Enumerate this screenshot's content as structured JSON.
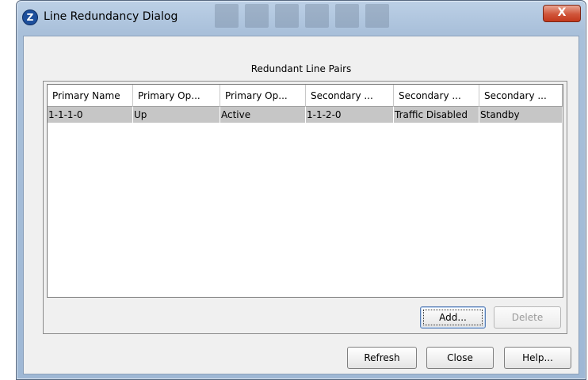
{
  "window": {
    "title": "Line Redundancy Dialog",
    "app_icon_glyph": "Z",
    "close_glyph": "X"
  },
  "group": {
    "title": "Redundant Line Pairs"
  },
  "table": {
    "columns": [
      "Primary Name",
      "Primary Op...",
      "Primary Op...",
      "Secondary ...",
      "Secondary ...",
      "Secondary ..."
    ],
    "rows": [
      [
        "1-1-1-0",
        "Up",
        "Active",
        "1-1-2-0",
        "Traffic Disabled",
        "Standby"
      ]
    ]
  },
  "buttons": {
    "add": "Add...",
    "delete": "Delete",
    "refresh": "Refresh",
    "close": "Close",
    "help": "Help..."
  },
  "colors": {
    "selected_row": "#c6c6c6",
    "title_bar": "#a9c0da",
    "close_button": "#d0553a"
  }
}
